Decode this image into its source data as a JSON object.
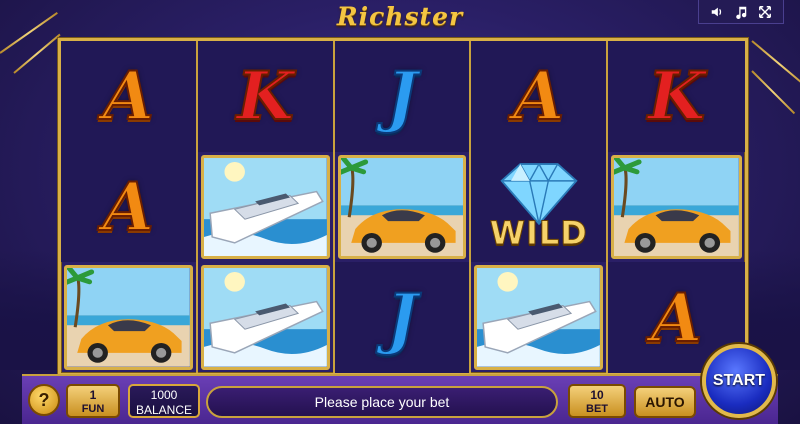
{
  "game": {
    "title": "Richster"
  },
  "controls": {
    "sound_icon": "speaker-icon",
    "music_icon": "music-note-icon",
    "fullscreen_icon": "fullscreen-icon"
  },
  "reels": [
    [
      {
        "type": "letter",
        "symbol": "A"
      },
      {
        "type": "letter",
        "symbol": "A"
      },
      {
        "type": "picture",
        "symbol": "car"
      }
    ],
    [
      {
        "type": "letter",
        "symbol": "K"
      },
      {
        "type": "picture",
        "symbol": "yacht"
      },
      {
        "type": "picture",
        "symbol": "yacht"
      }
    ],
    [
      {
        "type": "letter",
        "symbol": "J"
      },
      {
        "type": "picture",
        "symbol": "car"
      },
      {
        "type": "letter",
        "symbol": "J"
      }
    ],
    [
      {
        "type": "letter",
        "symbol": "A"
      },
      {
        "type": "wild",
        "symbol": "diamond",
        "label": "WILD"
      },
      {
        "type": "picture",
        "symbol": "yacht"
      }
    ],
    [
      {
        "type": "letter",
        "symbol": "K"
      },
      {
        "type": "picture",
        "symbol": "car"
      },
      {
        "type": "letter",
        "symbol": "A"
      }
    ]
  ],
  "bottom": {
    "help_label": "?",
    "fun_value": "1",
    "fun_label": "FUN",
    "balance_value": "1000",
    "balance_label": "BALANCE",
    "message": "Please place your bet",
    "bet_value": "10",
    "bet_label": "BET",
    "auto_label": "AUTO",
    "start_label": "START"
  },
  "colors": {
    "gold": "#d8b047",
    "background": "#2a1f66",
    "bar": "#5a32a0",
    "start": "#1a2cc0"
  }
}
